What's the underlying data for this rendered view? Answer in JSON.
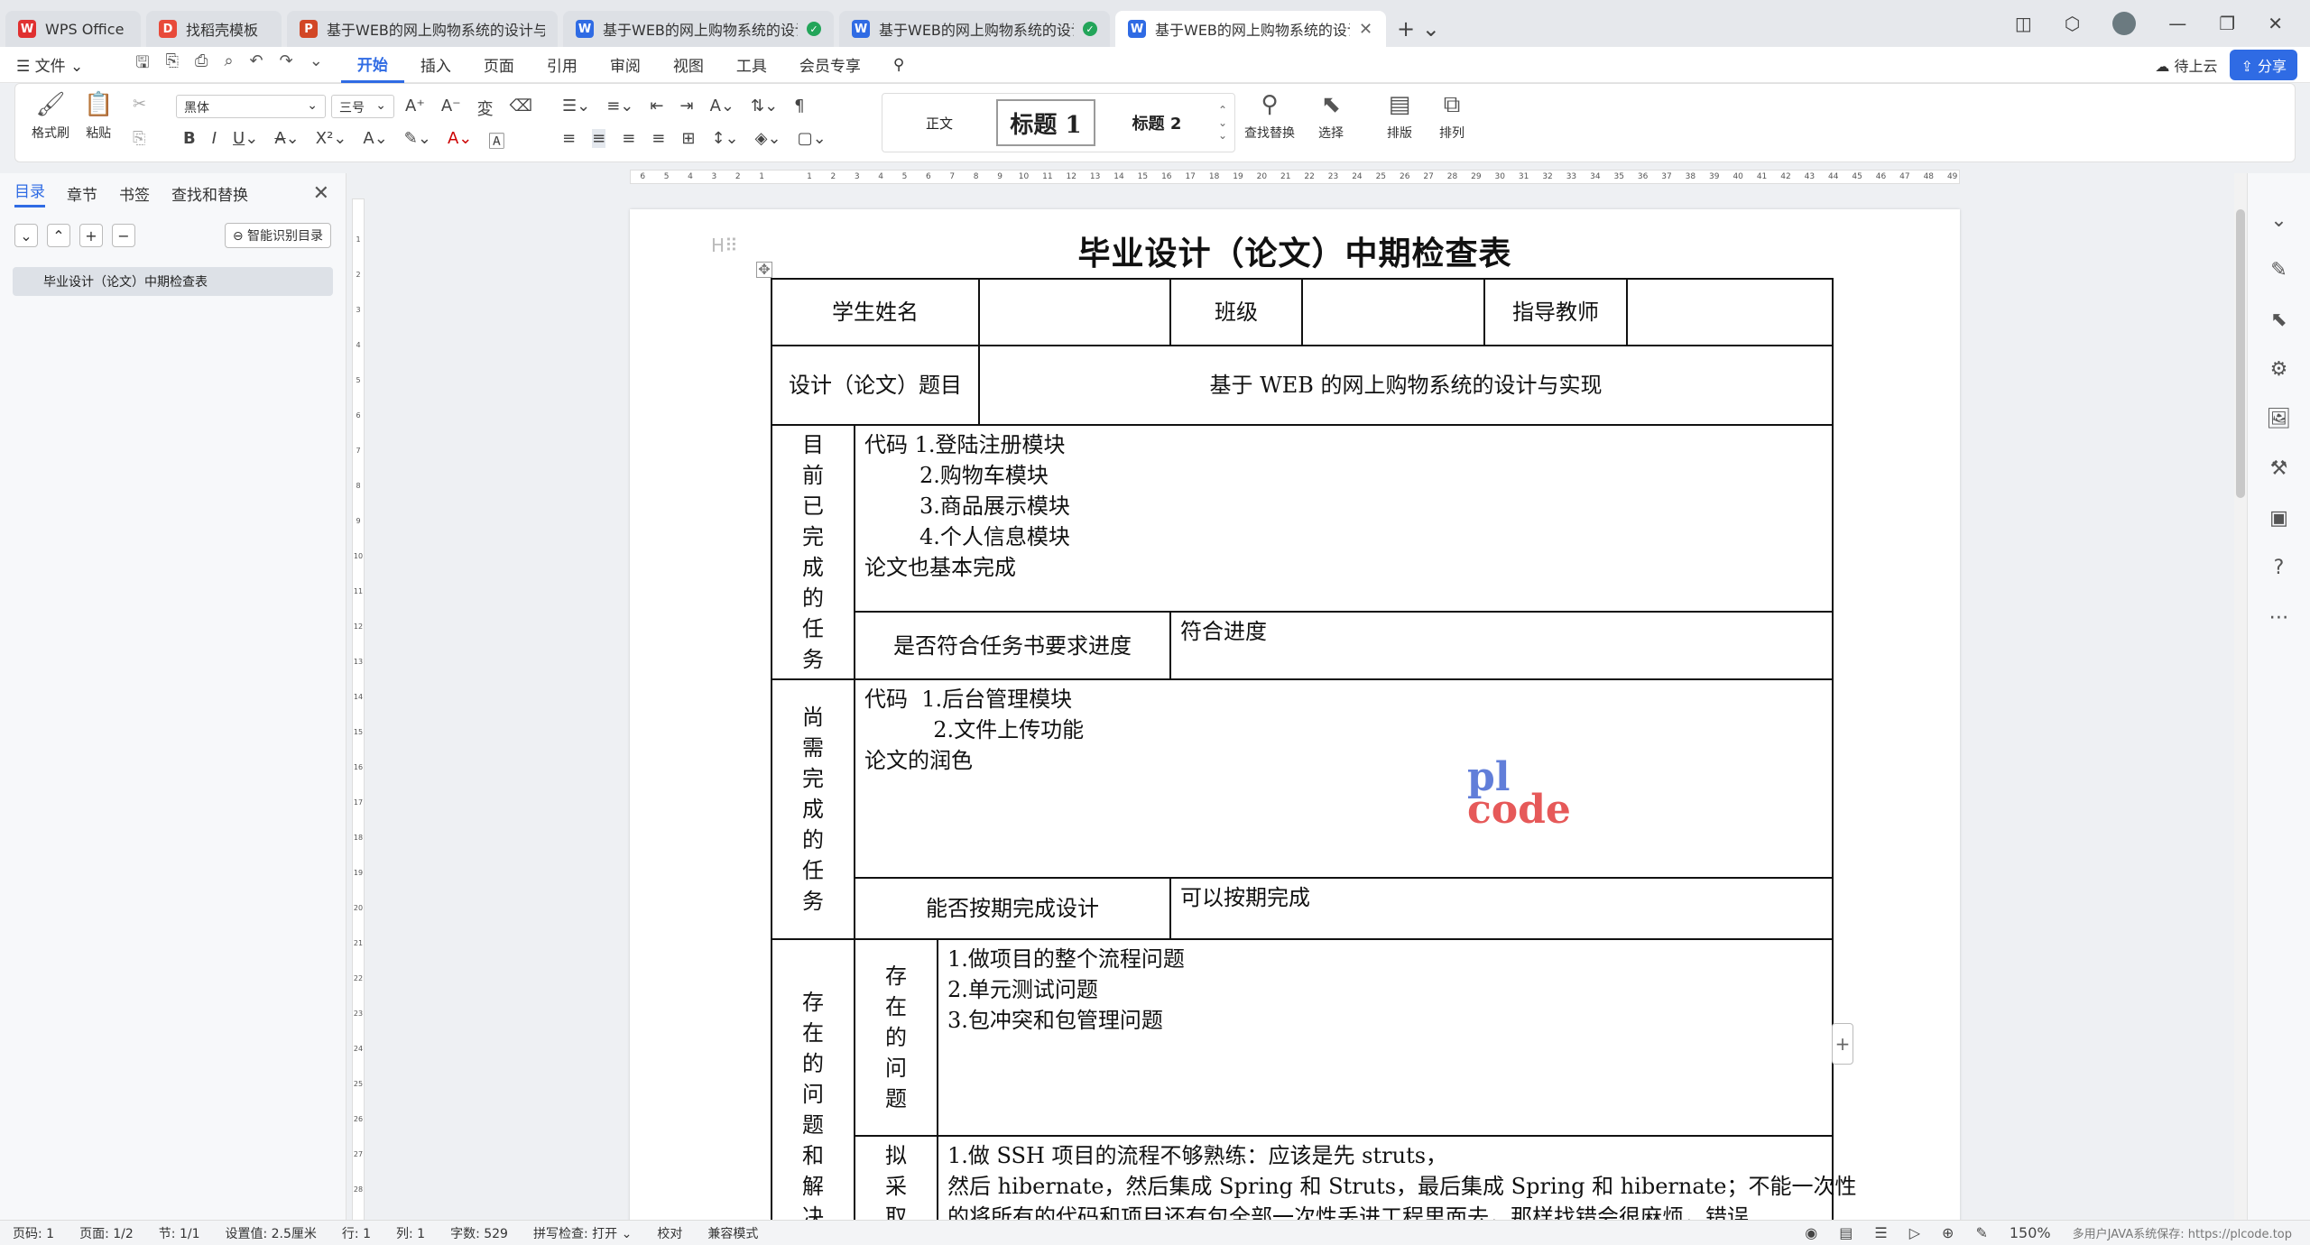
{
  "tabs": [
    {
      "label": "WPS Office",
      "icon": "wps-logo-icon",
      "color": "#e03030",
      "icon_text": "W"
    },
    {
      "label": "找稻壳模板",
      "icon": "docer-icon",
      "color": "#e84a3a",
      "icon_text": "D"
    },
    {
      "label": "基于WEB的网上购物系统的设计与实现",
      "icon": "ppt-icon",
      "color": "#d24726",
      "icon_text": "P"
    },
    {
      "label": "基于WEB的网上购物系统的设计与实现",
      "icon": "word-icon",
      "color": "#2f6be4",
      "icon_text": "W"
    },
    {
      "label": "基于WEB的网上购物系统的设计与实现",
      "icon": "word-icon",
      "color": "#2f6be4",
      "icon_text": "W"
    },
    {
      "label": "基于WEB的网上购物系统的设计与实现",
      "icon": "word-icon",
      "color": "#2f6be4",
      "icon_text": "W"
    }
  ],
  "menubar": {
    "file": "☰ 文件 ⌄",
    "items": [
      "开始",
      "插入",
      "页面",
      "引用",
      "审阅",
      "视图",
      "工具",
      "会员专享"
    ],
    "cloud": "待上云",
    "share": "分享"
  },
  "ribbon": {
    "format_painter": "格式刷",
    "paste": "粘贴",
    "font": "黑体",
    "size": "三号",
    "style_normal": "正文",
    "style_h1": "标题 1",
    "style_h2": "标题 2",
    "find_replace": "查找替换",
    "select": "选择",
    "layout": "排版",
    "arrange": "排列"
  },
  "navpane": {
    "tabs": [
      "目录",
      "章节",
      "书签",
      "查找和替换"
    ],
    "smart_button": "智能识别目录",
    "toc_item": "毕业设计（论文）中期检查表"
  },
  "ruler_labels": [
    "6",
    "5",
    "4",
    "3",
    "2",
    "1",
    "",
    "1",
    "2",
    "3",
    "4",
    "5",
    "6",
    "7",
    "8",
    "9",
    "10",
    "11",
    "12",
    "13",
    "14",
    "15",
    "16",
    "17",
    "18",
    "19",
    "20",
    "21",
    "22",
    "23",
    "24",
    "25",
    "26",
    "27",
    "28",
    "29",
    "30",
    "31",
    "32",
    "33",
    "34",
    "35",
    "36",
    "37",
    "38",
    "39",
    "40",
    "41",
    "42",
    "43",
    "44",
    "45",
    "46",
    "47",
    "48",
    "49"
  ],
  "vruler_labels": [
    "1",
    "2",
    "3",
    "4",
    "5",
    "6",
    "7",
    "8",
    "9",
    "10",
    "11",
    "12",
    "13",
    "14",
    "15",
    "16",
    "17",
    "18",
    "19",
    "20",
    "21",
    "22",
    "23",
    "24",
    "25",
    "26",
    "27",
    "28"
  ],
  "document": {
    "title": "毕业设计（论文）中期检查表",
    "student_name_label": "学生姓名",
    "class_label": "班级",
    "advisor_label": "指导教师",
    "topic_label": "设计（论文）题目",
    "topic_value": "基于 WEB 的网上购物系统的设计与实现",
    "completed_label": [
      "目",
      "前",
      "已",
      "完",
      "成",
      "的",
      "任",
      "务"
    ],
    "completed_lines": [
      "代码 1.登陆注册模块",
      "        2.购物车模块",
      "        3.商品展示模块",
      "        4.个人信息模块",
      "论文也基本完成"
    ],
    "progress_label": "是否符合任务书要求进度",
    "progress_value": "符合进度",
    "pending_label": [
      "尚",
      "需",
      "完",
      "成",
      "的",
      "任",
      "务"
    ],
    "pending_lines": [
      "代码  1.后台管理模块",
      "          2.文件上传功能",
      "论文的润色"
    ],
    "ontime_label": "能否按期完成设计",
    "ontime_value": "可以按期完成",
    "issues_outer_label": [
      "存",
      "在",
      "的",
      "问",
      "题",
      "和",
      "解",
      "决"
    ],
    "issues_label": [
      "存",
      "在",
      "的",
      "问",
      "题"
    ],
    "issues_lines": [
      "1.做项目的整个流程问题",
      "2.单元测试问题",
      "3.包冲突和包管理问题"
    ],
    "plan_label": [
      "拟",
      "采",
      "取"
    ],
    "plan_lines": [
      "1.做 SSH 项目的流程不够熟练：应该是先 struts，",
      "然后 hibernate，然后集成 Spring 和 Struts，最后集成 Spring 和 hibernate；不能一次性",
      "的将所有的代码和项目还有包全部一次性丢进工程里面去，那样找错会很麻烦，错误"
    ]
  },
  "watermark": {
    "line1": "pl",
    "line2": "code"
  },
  "statusbar": {
    "page_num": "页码: 1",
    "pages": "页面: 1/2",
    "section": "节: 1/1",
    "setting": "设置值: 2.5厘米",
    "row": "行: 1",
    "col": "列: 1",
    "words": "字数: 529",
    "spell": "拼写检查: 打开 ⌄",
    "proof": "校对",
    "compat": "兼容模式",
    "zoom": "150%",
    "url": "多用户JAVA系统保存: https://plcode.top"
  }
}
